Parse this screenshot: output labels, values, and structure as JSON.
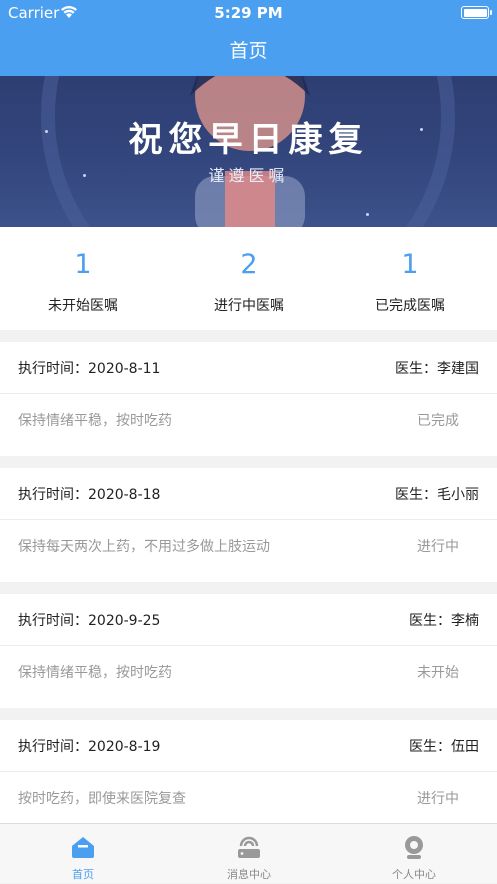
{
  "status_bar": {
    "carrier": "Carrier",
    "time": "5:29 PM"
  },
  "nav": {
    "title": "首页"
  },
  "banner": {
    "title": "祝您早日康复",
    "subtitle": "谨遵医嘱"
  },
  "stats": [
    {
      "count": "1",
      "label": "未开始医嘱"
    },
    {
      "count": "2",
      "label": "进行中医嘱"
    },
    {
      "count": "1",
      "label": "已完成医嘱"
    }
  ],
  "orders": [
    {
      "time_label": "执行时间：2020-8-11",
      "doctor": "医生：李建国",
      "content": "保持情绪平稳，按时吃药",
      "status": "已完成"
    },
    {
      "time_label": "执行时间：2020-8-18",
      "doctor": "医生：毛小丽",
      "content": "保持每天两次上药，不用过多做上肢运动",
      "status": "进行中"
    },
    {
      "time_label": "执行时间：2020-9-25",
      "doctor": "医生：李楠",
      "content": "保持情绪平稳，按时吃药",
      "status": "未开始"
    },
    {
      "time_label": "执行时间：2020-8-19",
      "doctor": "医生：伍田",
      "content": "按时吃药，即使来医院复查",
      "status": "进行中"
    }
  ],
  "tabbar": [
    {
      "label": "首页",
      "icon": "home-icon",
      "active": true
    },
    {
      "label": "消息中心",
      "icon": "message-icon",
      "active": false
    },
    {
      "label": "个人中心",
      "icon": "profile-icon",
      "active": false
    }
  ],
  "colors": {
    "primary": "#4a9ff0",
    "banner_bg": "#33467d",
    "muted_text": "#999999"
  }
}
